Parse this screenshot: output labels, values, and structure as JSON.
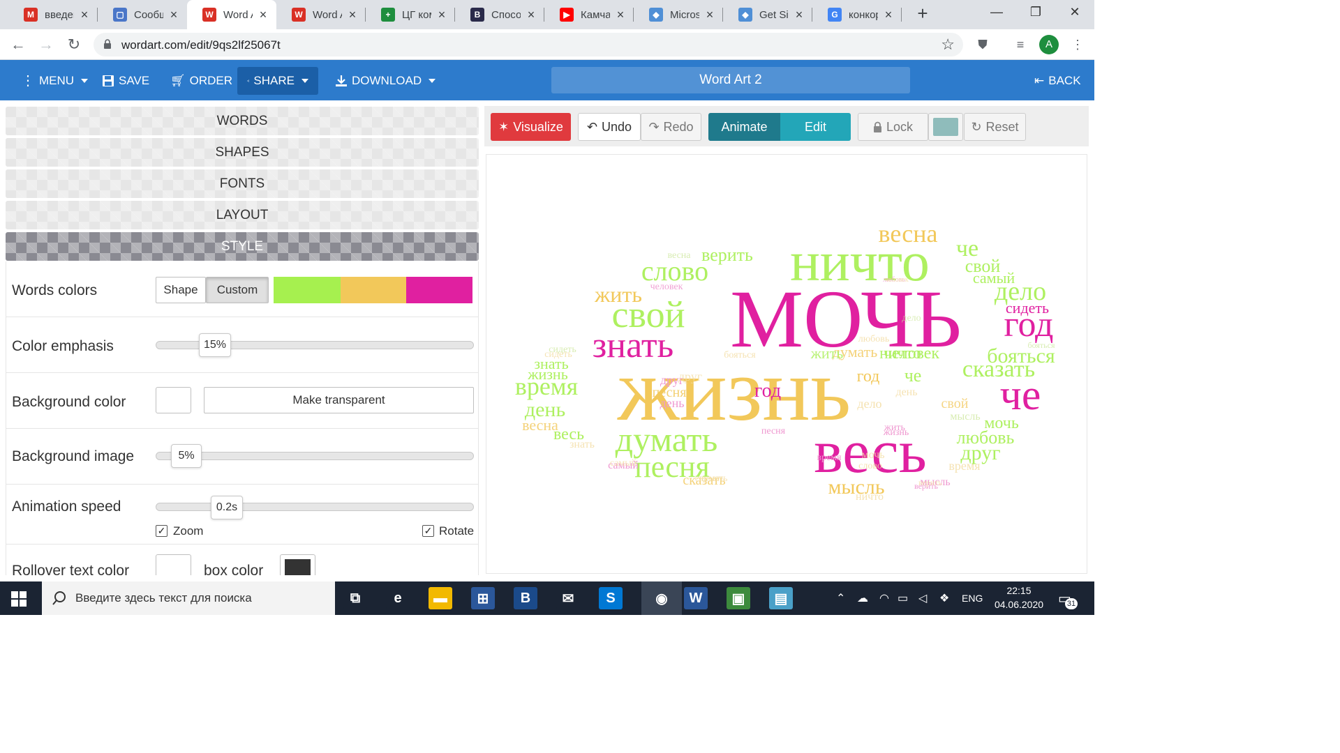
{
  "browser": {
    "tabs": [
      {
        "title": "введени",
        "icon": "gmail-icon",
        "color": "#d93025",
        "glyph": "M"
      },
      {
        "title": "Сообщен",
        "icon": "chat-icon",
        "color": "#4a76c8",
        "glyph": "▢"
      },
      {
        "title": "Word Ar",
        "icon": "wordart-icon",
        "color": "#d93025",
        "glyph": "W"
      },
      {
        "title": "Word Ar",
        "icon": "wordart-icon",
        "color": "#d93025",
        "glyph": "W"
      },
      {
        "title": "ЦГ ком",
        "icon": "sheets-icon",
        "color": "#1e8e3e",
        "glyph": "+"
      },
      {
        "title": "Способ",
        "icon": "b-icon",
        "color": "#2a2a4a",
        "glyph": "B"
      },
      {
        "title": "Камчат",
        "icon": "youtube-icon",
        "color": "#ff0000",
        "glyph": "▶"
      },
      {
        "title": "Microso",
        "icon": "shield-icon",
        "color": "#4f8fd6",
        "glyph": "◆"
      },
      {
        "title": "Get Silv",
        "icon": "shield-icon",
        "color": "#4f8fd6",
        "glyph": "◆"
      },
      {
        "title": "конкор",
        "icon": "google-icon",
        "color": "#4285f4",
        "glyph": "G"
      }
    ],
    "active_tab": 2,
    "url": "wordart.com/edit/9qs2lf25067t",
    "profile_initial": "A"
  },
  "toolbar": {
    "menu": "MENU",
    "save": "SAVE",
    "order": "ORDER",
    "share": "SHARE",
    "download": "DOWNLOAD",
    "title": "Word Art 2",
    "back": "BACK"
  },
  "left_panel": {
    "sections": [
      "WORDS",
      "SHAPES",
      "FONTS",
      "LAYOUT",
      "STYLE"
    ],
    "active_section": "STYLE",
    "words_colors": {
      "label": "Words colors",
      "shape_btn": "Shape",
      "custom_btn": "Custom",
      "colors": [
        "#a6f04f",
        "#f2c85a",
        "#e020a0"
      ]
    },
    "color_emphasis": {
      "label": "Color emphasis",
      "value_text": "15%",
      "value": 0.15
    },
    "background_color": {
      "label": "Background color",
      "swatch": "#ffffff",
      "transparent_btn": "Make transparent"
    },
    "background_image": {
      "label": "Background image",
      "value_text": "5%",
      "value": 0.05
    },
    "animation_speed": {
      "label": "Animation speed",
      "value_text": "0.2s",
      "zoom": "Zoom",
      "rotate": "Rotate",
      "zoom_checked": true,
      "rotate_checked": true
    },
    "rollover": {
      "label": "Rollover text color",
      "box_color_label": "box color",
      "text_swatch": "#ffffff",
      "box_swatch": "#333333"
    }
  },
  "editor_toolbar": {
    "visualize": "Visualize",
    "undo": "Undo",
    "redo": "Redo",
    "animate": "Animate",
    "edit": "Edit",
    "lock": "Lock",
    "reset": "Reset",
    "swatch_color": "#8fbcbb"
  },
  "wordcloud": {
    "colors": {
      "green": "#aef060",
      "yellow": "#f2c85a",
      "pink": "#e020a0",
      "lgreen": "#cfe8a0",
      "lyellow": "#f3dca0",
      "lpink": "#ef98d0"
    },
    "words": [
      {
        "t": "жизнь",
        "c": "yellow"
      },
      {
        "t": "МОЧЬ",
        "c": "pink"
      },
      {
        "t": "ничто",
        "c": "green"
      },
      {
        "t": "весь",
        "c": "pink"
      },
      {
        "t": "знать",
        "c": "pink"
      },
      {
        "t": "свой",
        "c": "green"
      },
      {
        "t": "год",
        "c": "pink"
      },
      {
        "t": "че",
        "c": "pink"
      },
      {
        "t": "думать",
        "c": "green"
      },
      {
        "t": "песня",
        "c": "green"
      },
      {
        "t": "время",
        "c": "green"
      },
      {
        "t": "слово",
        "c": "green"
      },
      {
        "t": "весна",
        "c": "yellow"
      },
      {
        "t": "дело",
        "c": "green"
      },
      {
        "t": "сказать",
        "c": "green"
      },
      {
        "t": "бояться",
        "c": "green"
      },
      {
        "t": "день",
        "c": "green"
      },
      {
        "t": "жить",
        "c": "yellow"
      },
      {
        "t": "че",
        "c": "green"
      },
      {
        "t": "свой",
        "c": "green"
      },
      {
        "t": "самый",
        "c": "green"
      },
      {
        "t": "сидеть",
        "c": "pink"
      },
      {
        "t": "мысль",
        "c": "yellow"
      },
      {
        "t": "любовь",
        "c": "green"
      },
      {
        "t": "друг",
        "c": "green"
      },
      {
        "t": "мочь",
        "c": "green"
      },
      {
        "t": "верить",
        "c": "green"
      },
      {
        "t": "год",
        "c": "pink"
      },
      {
        "t": "знать",
        "c": "green"
      },
      {
        "t": "жизнь",
        "c": "green"
      },
      {
        "t": "весь",
        "c": "green"
      },
      {
        "t": "песня",
        "c": "yellow"
      },
      {
        "t": "думать",
        "c": "yellow"
      },
      {
        "t": "сказать",
        "c": "yellow"
      },
      {
        "t": "человек",
        "c": "green"
      },
      {
        "t": "ничто",
        "c": "green"
      },
      {
        "t": "жить",
        "c": "green"
      },
      {
        "t": "друг",
        "c": "pink"
      },
      {
        "t": "день",
        "c": "pink"
      },
      {
        "t": "самый",
        "c": "pink"
      },
      {
        "t": "мысль",
        "c": "pink"
      },
      {
        "t": "весна",
        "c": "yellow"
      },
      {
        "t": "дело",
        "c": "yellow"
      },
      {
        "t": "человек",
        "c": "pink"
      },
      {
        "t": "песня",
        "c": "pink"
      },
      {
        "t": "жизнь",
        "c": "pink"
      },
      {
        "t": "время",
        "c": "pink"
      },
      {
        "t": "верить",
        "c": "pink"
      },
      {
        "t": "друг",
        "c": "yellow"
      },
      {
        "t": "че",
        "c": "green"
      },
      {
        "t": "слово",
        "c": "yellow"
      },
      {
        "t": "бояться",
        "c": "yellow"
      },
      {
        "t": "год",
        "c": "yellow"
      },
      {
        "t": "сидеть",
        "c": "yellow"
      },
      {
        "t": "мочь",
        "c": "yellow"
      },
      {
        "t": "любовь",
        "c": "yellow"
      },
      {
        "t": "ничто",
        "c": "yellow"
      },
      {
        "t": "жить",
        "c": "pink"
      },
      {
        "t": "сказать",
        "c": "yellow"
      },
      {
        "t": "думать",
        "c": "yellow"
      },
      {
        "t": "весна",
        "c": "green"
      },
      {
        "t": "время",
        "c": "yellow"
      },
      {
        "t": "свой",
        "c": "yellow"
      },
      {
        "t": "день",
        "c": "yellow"
      },
      {
        "t": "знать",
        "c": "yellow"
      },
      {
        "t": "самый",
        "c": "yellow"
      },
      {
        "t": "сидеть",
        "c": "green"
      },
      {
        "t": "бояться",
        "c": "green"
      },
      {
        "t": "любовь",
        "c": "pink"
      },
      {
        "t": "человек",
        "c": "yellow"
      },
      {
        "t": "мысль",
        "c": "green"
      },
      {
        "t": "дело",
        "c": "green"
      },
      {
        "t": "верить",
        "c": "yellow"
      }
    ]
  },
  "taskbar": {
    "search_placeholder": "Введите здесь текст для поиска",
    "lang": "ENG",
    "time": "22:15",
    "date": "04.06.2020",
    "notifications": "31",
    "apps": [
      {
        "name": "task-view-icon",
        "glyph": "⧉",
        "color": "#1b2433"
      },
      {
        "name": "edge-icon",
        "glyph": "e",
        "color": "#1b2433"
      },
      {
        "name": "file-explorer-icon",
        "glyph": "▬",
        "color": "#f2b900"
      },
      {
        "name": "store-icon",
        "glyph": "⊞",
        "color": "#2b579a"
      },
      {
        "name": "b-app-icon",
        "glyph": "B",
        "color": "#1b4a8a"
      },
      {
        "name": "mail-icon",
        "glyph": "✉",
        "color": "#1b2433"
      },
      {
        "name": "skype-icon",
        "glyph": "S",
        "color": "#0078d4"
      },
      {
        "name": "chrome-icon",
        "glyph": "◉",
        "color": "#3a4556"
      },
      {
        "name": "word-icon",
        "glyph": "W",
        "color": "#2b579a"
      },
      {
        "name": "photo-icon",
        "glyph": "▣",
        "color": "#3d8b3d"
      },
      {
        "name": "notepad-icon",
        "glyph": "▤",
        "color": "#4aa0c8"
      }
    ]
  }
}
